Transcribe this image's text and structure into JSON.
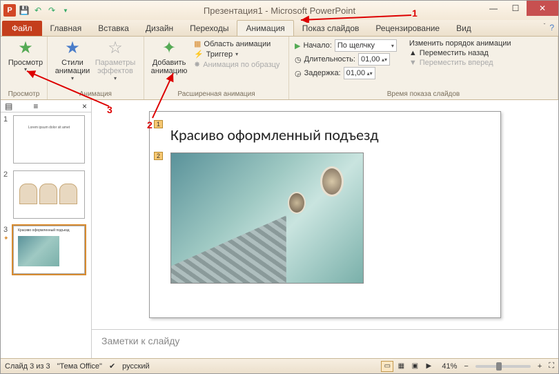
{
  "title": "Презентация1 - Microsoft PowerPoint",
  "app_letter": "P",
  "tabs": {
    "file": "Файл",
    "items": [
      "Главная",
      "Вставка",
      "Дизайн",
      "Переходы",
      "Анимация",
      "Показ слайдов",
      "Рецензирование",
      "Вид"
    ],
    "active_index": 4
  },
  "ribbon": {
    "preview": {
      "label": "Просмотр",
      "group": "Просмотр"
    },
    "styles": {
      "label": "Стили анимации",
      "params": "Параметры эффектов",
      "group": "Анимация"
    },
    "add": {
      "label": "Добавить анимацию",
      "pane": "Область анимации",
      "trigger": "Триггер",
      "painter": "Анимация по образцу",
      "group": "Расширенная анимация"
    },
    "timing": {
      "start": "Начало:",
      "start_val": "По щелчку",
      "dur": "Длительность:",
      "dur_val": "01,00",
      "delay": "Задержка:",
      "delay_val": "01,00",
      "reorder": "Изменить порядок анимации",
      "move_back": "Переместить назад",
      "move_fwd": "Переместить вперед",
      "group": "Время показа слайдов"
    }
  },
  "slide": {
    "title": "Красиво оформленный подъезд",
    "tag1": "1",
    "tag2": "2"
  },
  "thumbs": [
    "1",
    "2",
    "3"
  ],
  "notes_placeholder": "Заметки к слайду",
  "status": {
    "slide_of": "Слайд 3 из 3",
    "theme": "\"Тема Office\"",
    "lang": "русский",
    "zoom": "41%"
  },
  "annotations": {
    "a1": "1",
    "a2": "2",
    "a3": "3"
  }
}
